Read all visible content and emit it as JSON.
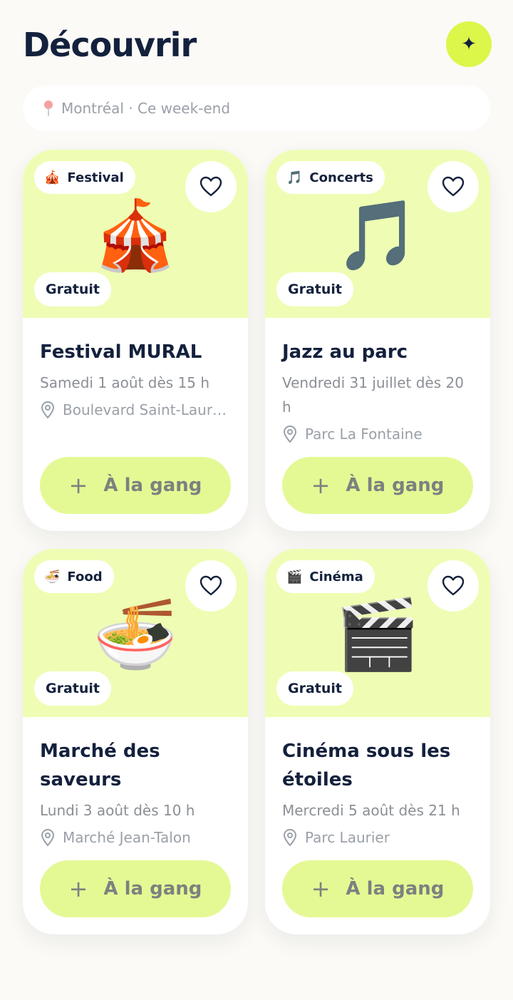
{
  "header": {
    "title": "Découvrir",
    "action_icon": "sparkle-icon"
  },
  "search": {
    "icon": "map-pin-icon",
    "text": "Montréal · Ce week-end"
  },
  "colors": {
    "accent": "#dcf74a",
    "card_top": "#eefdb3",
    "button": "#e4f994",
    "text": "#14213d"
  },
  "events": [
    {
      "category_emoji": "🎪",
      "category": "Festival",
      "hero_emoji": "🎪",
      "price": "Gratuit",
      "title": "Festival MURAL",
      "date": "Samedi 1 août dès 15 h",
      "place": "Boulevard Saint-Laur…",
      "button": "À la gang",
      "favorite_icon": "heart-icon"
    },
    {
      "category_emoji": "🎵",
      "category": "Concerts",
      "hero_emoji": "🎵",
      "price": "Gratuit",
      "title": "Jazz au parc",
      "date": "Vendredi 31 juillet dès 20 h",
      "place": "Parc La Fontaine",
      "button": "À la gang",
      "favorite_icon": "heart-icon"
    },
    {
      "category_emoji": "🍜",
      "category": "Food",
      "hero_emoji": "🍜",
      "price": "Gratuit",
      "title": "Marché des saveurs",
      "date": "Lundi 3 août dès 10 h",
      "place": "Marché Jean-Talon",
      "button": "À la gang",
      "favorite_icon": "heart-icon"
    },
    {
      "category_emoji": "🎬",
      "category": "Cinéma",
      "hero_emoji": "🎬",
      "price": "Gratuit",
      "title": "Cinéma sous les étoiles",
      "date": "Mercredi 5 août dès 21 h",
      "place": "Parc Laurier",
      "button": "À la gang",
      "favorite_icon": "heart-icon"
    }
  ]
}
